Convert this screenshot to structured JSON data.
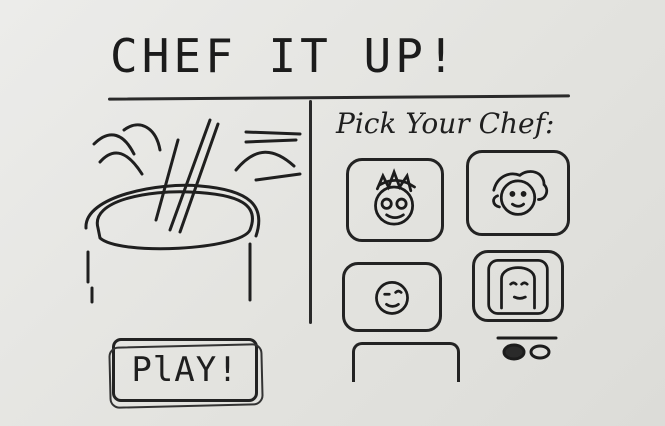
{
  "title": "CHEF IT UP!",
  "play": {
    "label": "PlAY!"
  },
  "picker": {
    "title": "Pick Your Chef:",
    "chefs": [
      {
        "icon": "chef-face-spiky-hair-icon"
      },
      {
        "icon": "chef-face-curly-hair-icon"
      },
      {
        "icon": "chef-face-winking-icon"
      },
      {
        "icon": "chef-face-long-hair-icon"
      },
      {
        "icon": "chef-card-partial"
      },
      {
        "icon": "chef-face-partial-icon"
      }
    ]
  }
}
